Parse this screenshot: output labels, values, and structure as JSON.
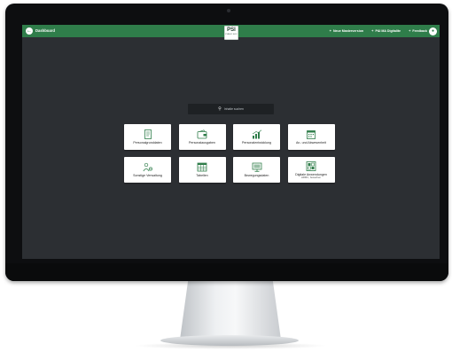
{
  "topbar": {
    "back_label": "Dashboard",
    "logo_text": "PSI",
    "logo_sub": "PUBLIC SOC",
    "links": [
      {
        "label": "Neue Masterversion",
        "icon": "plus-icon"
      },
      {
        "label": "P&I MA Digitalite",
        "icon": "plus-icon"
      },
      {
        "label": "Feedback",
        "icon": "plus-icon"
      }
    ],
    "chat_icon": "chat-bubble-icon"
  },
  "search": {
    "placeholder": "Inhalte suchen",
    "icon": "search-icon"
  },
  "tiles": [
    {
      "label": "Personalgrunddaten",
      "sub": "",
      "icon": "document-icon"
    },
    {
      "label": "Personalausgaben",
      "sub": "",
      "icon": "wallet-icon"
    },
    {
      "label": "Personalentwicklung",
      "sub": "",
      "icon": "growth-chart-icon"
    },
    {
      "label": "An- und Abwesenheit",
      "sub": "",
      "icon": "calendar-icon"
    },
    {
      "label": "Sonstige Verwaltung",
      "sub": "",
      "icon": "people-gear-icon"
    },
    {
      "label": "Tabellen",
      "sub": "",
      "icon": "table-icon"
    },
    {
      "label": "Bewegungsdaten",
      "sub": "",
      "icon": "monitor-icon"
    },
    {
      "label": "Digitale Anwendungen",
      "sub": "HRMC, bewerben",
      "icon": "apps-icon"
    }
  ],
  "colors": {
    "brand": "#2f7d4a",
    "screen_bg": "#2c2f33",
    "tile_icon": "#2f7d4a"
  }
}
